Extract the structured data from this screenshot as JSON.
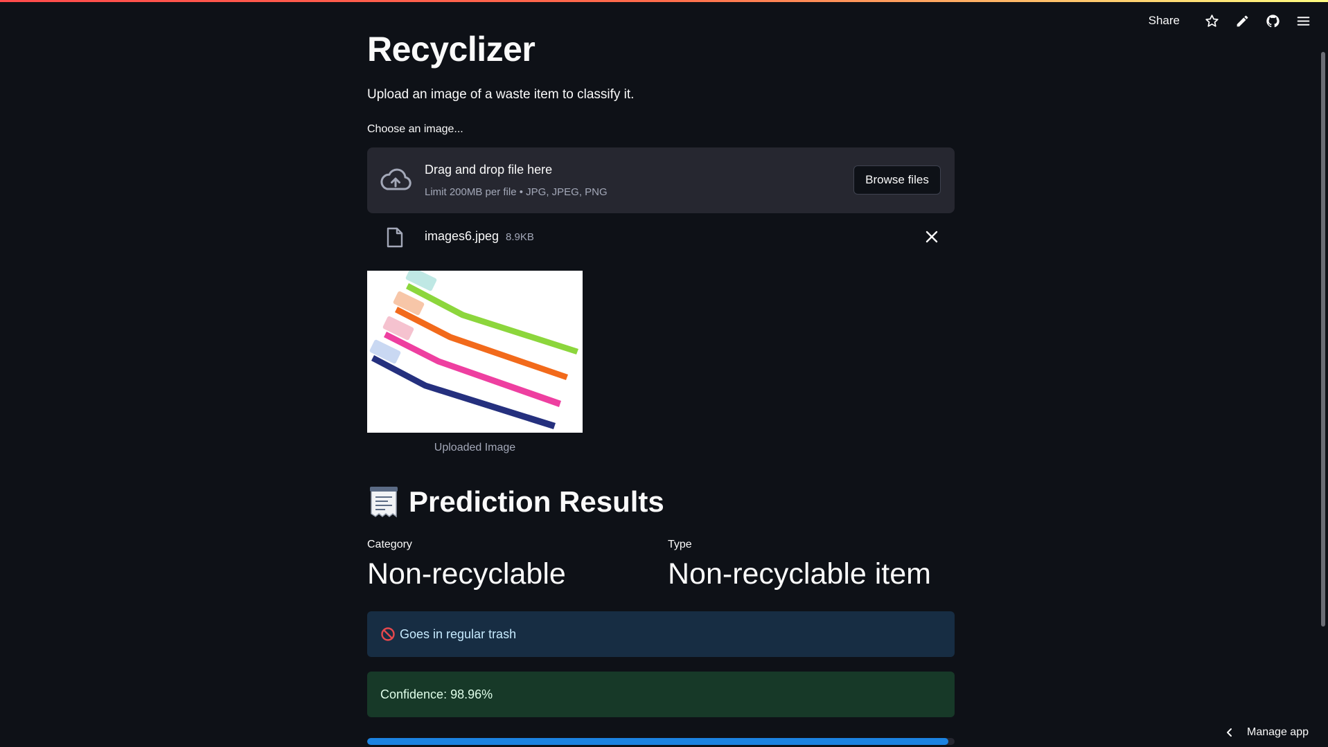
{
  "header": {
    "share_label": "Share",
    "icons": [
      "star-icon",
      "pencil-icon",
      "github-icon",
      "menu-icon"
    ]
  },
  "main": {
    "title": "Recyclizer",
    "subtitle": "Upload an image of a waste item to classify it."
  },
  "uploader": {
    "label": "Choose an image...",
    "drop_title": "Drag and drop file here",
    "limit_text": "Limit 200MB per file • JPG, JPEG, PNG",
    "browse_label": "Browse files",
    "file": {
      "name": "images6.jpeg",
      "size": "8.9KB"
    }
  },
  "preview": {
    "caption": "Uploaded Image",
    "toothbrush_colors": [
      "#8cd63c",
      "#f26a1b",
      "#ee3fa0",
      "#25307e"
    ]
  },
  "results": {
    "title": "Prediction Results",
    "category_label": "Category",
    "category_value": "Non-recyclable",
    "type_label": "Type",
    "type_value": "Non-recyclable item",
    "disposal_text": "Goes in regular trash",
    "confidence_text": "Confidence: 98.96%",
    "confidence_value": 0.9896
  },
  "footer": {
    "manage_label": "Manage app"
  },
  "colors": {
    "background": "#0e1117",
    "info_bg": "#172d43",
    "success_bg": "#173928",
    "progress": "#1c83e1"
  }
}
